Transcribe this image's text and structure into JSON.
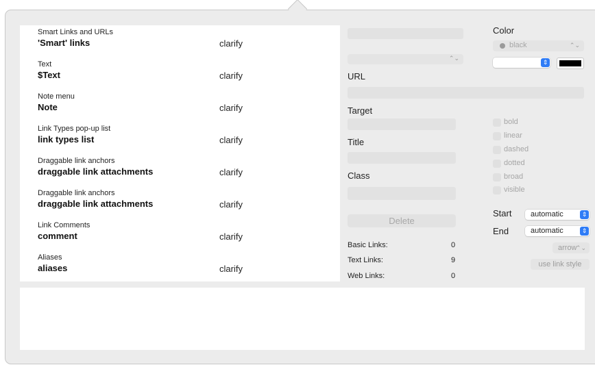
{
  "list": {
    "items": [
      {
        "category": "Smart Links and URLs",
        "name": "'Smart' links",
        "action": "clarify"
      },
      {
        "category": "Text",
        "name": "$Text",
        "action": "clarify"
      },
      {
        "category": "Note menu",
        "name": "Note",
        "action": "clarify"
      },
      {
        "category": "Link Types pop-up list",
        "name": "link types list",
        "action": "clarify"
      },
      {
        "category": "Draggable link anchors",
        "name": "draggable link attachments",
        "action": "clarify"
      },
      {
        "category": "Draggable link anchors",
        "name": "draggable link attachments",
        "action": "clarify"
      },
      {
        "category": "Link Comments",
        "name": "comment",
        "action": "clarify"
      },
      {
        "category": "Aliases",
        "name": "aliases",
        "action": "clarify"
      }
    ]
  },
  "form": {
    "url_label": "URL",
    "target_label": "Target",
    "title_label": "Title",
    "class_label": "Class",
    "delete_label": "Delete"
  },
  "stats": {
    "basic_label": "Basic Links:",
    "basic_value": "0",
    "text_label": "Text Links:",
    "text_value": "9",
    "web_label": "Web Links:",
    "web_value": "0"
  },
  "style": {
    "color_label": "Color",
    "color_value": "black",
    "swatch_color": "#000000",
    "checkboxes": [
      "bold",
      "linear",
      "dashed",
      "dotted",
      "broad",
      "visible"
    ],
    "start_label": "Start",
    "start_value": "automatic",
    "end_label": "End",
    "end_value": "automatic",
    "arrow_value": "arrow",
    "use_link_style_label": "use link style"
  },
  "colors": {
    "accent": "#2f7cf6",
    "panel": "#ececec"
  }
}
